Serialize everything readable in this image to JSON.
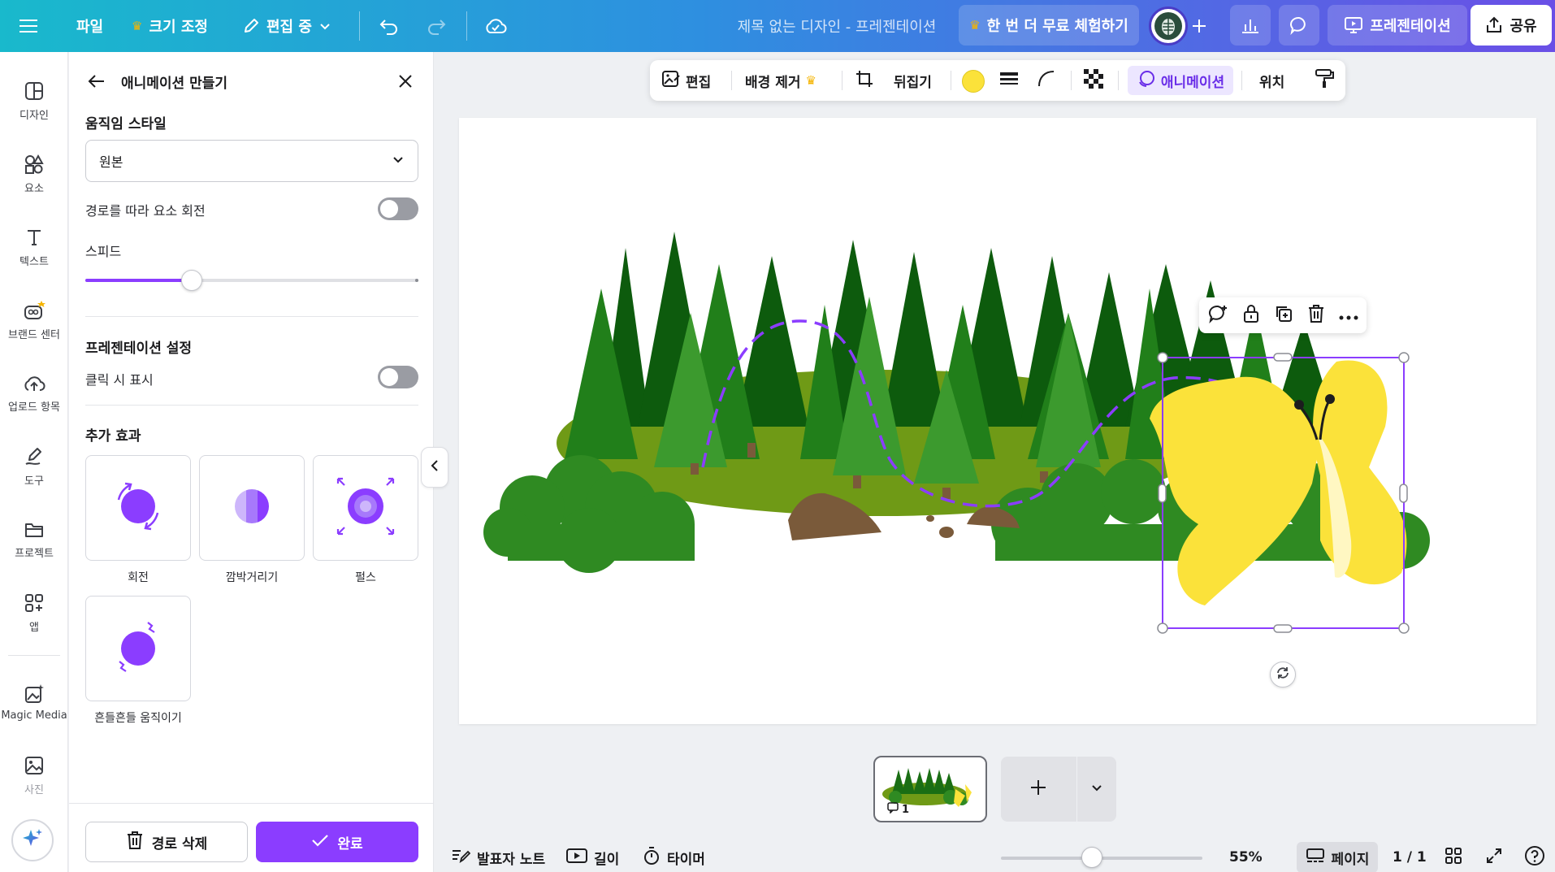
{
  "topbar": {
    "file_label": "파일",
    "resize_label": "크기 조정",
    "editing_label": "편집 중",
    "doc_title": "제목 없는 디자인 - 프레젠테이션",
    "trial_label": "한 번 더 무료 체험하기",
    "present_label": "프레젠테이션",
    "share_label": "공유"
  },
  "rail": {
    "items": [
      {
        "label": "디자인",
        "icon": "design-icon"
      },
      {
        "label": "요소",
        "icon": "elements-icon"
      },
      {
        "label": "텍스트",
        "icon": "text-icon"
      },
      {
        "label": "브랜드 센터",
        "icon": "brand-icon"
      },
      {
        "label": "업로드 항목",
        "icon": "upload-icon"
      },
      {
        "label": "도구",
        "icon": "draw-icon"
      },
      {
        "label": "프로젝트",
        "icon": "folder-icon"
      },
      {
        "label": "앱",
        "icon": "apps-icon"
      },
      {
        "label": "Magic Media",
        "icon": "magic-media-icon"
      },
      {
        "label": "사진",
        "icon": "photo-icon"
      }
    ]
  },
  "panel": {
    "title": "애니메이션 만들기",
    "motion_style_title": "움직임 스타일",
    "motion_style_value": "원본",
    "rotate_along_path_label": "경로를 따라 요소 회전",
    "rotate_along_path_on": false,
    "speed_label": "스피드",
    "speed_value": 0.32,
    "presentation_settings_title": "프레젠테이션 설정",
    "show_on_click_label": "클릭 시 표시",
    "show_on_click_on": false,
    "extra_effects_title": "추가 효과",
    "effects": [
      {
        "label": "회전",
        "icon": "rotate-effect-icon"
      },
      {
        "label": "깜박거리기",
        "icon": "blink-effect-icon"
      },
      {
        "label": "펄스",
        "icon": "pulse-effect-icon"
      },
      {
        "label": "흔들흔들 움직이기",
        "icon": "wiggle-effect-icon"
      }
    ],
    "delete_path_label": "경로 삭제",
    "done_label": "완료"
  },
  "context_toolbar": {
    "edit_label": "편집",
    "bg_remove_label": "배경 제거",
    "flip_label": "뒤집기",
    "animation_label": "애니메이션",
    "position_label": "위치",
    "fill_color": "#fbe23a"
  },
  "bottom": {
    "page_number": "1",
    "notes_label": "발표자 노트",
    "duration_label": "길이",
    "timer_label": "타이머",
    "zoom_value": "55%",
    "zoom_fraction": 0.45,
    "pages_label": "페이지",
    "page_count": "1 / 1"
  },
  "colors": {
    "accent": "#8b3dff",
    "butterfly": "#fbe23a"
  }
}
